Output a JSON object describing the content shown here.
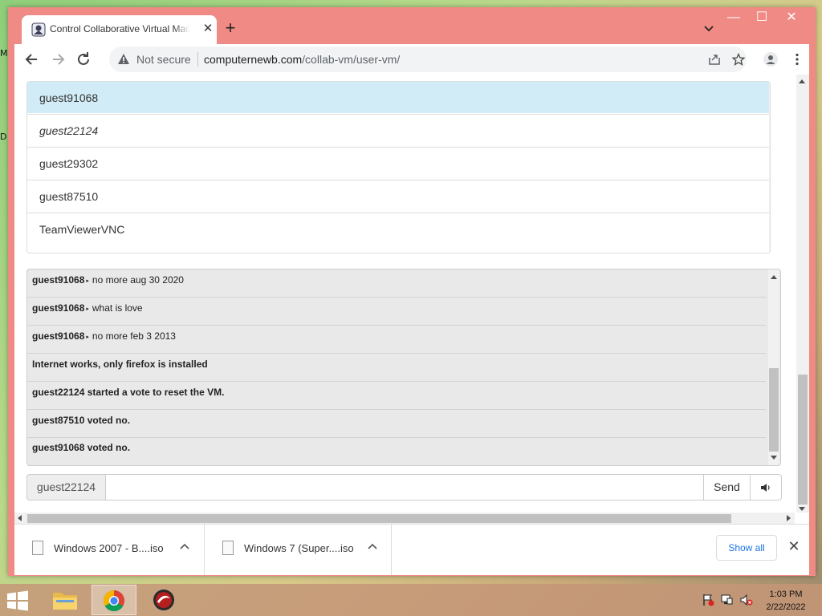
{
  "desktop": {
    "icon_labels": [
      "M",
      "D"
    ]
  },
  "tab": {
    "title": "Control Collaborative Virtual Machine",
    "close": "✕"
  },
  "window_controls": {
    "minimize": "—",
    "maximize": "☐",
    "close": "✕"
  },
  "new_tab": "+",
  "omnibox": {
    "security": "Not secure",
    "url_host": "computernewb.com",
    "url_path": "/collab-vm/user-vm/"
  },
  "users": [
    "guest91068",
    "guest22124",
    "guest29302",
    "guest87510",
    "TeamViewerVNC"
  ],
  "chat": {
    "messages": [
      {
        "user": "guest91068",
        "text": "no more aug 30 2020"
      },
      {
        "user": "guest91068",
        "text": "what is love"
      },
      {
        "user": "guest91068",
        "text": "no more feb 3 2013"
      }
    ],
    "system": [
      "Internet works, only firefox is installed",
      "guest22124 started a vote to reset the VM.",
      "guest87510 voted no.",
      "guest91068 voted no."
    ],
    "username": "guest22124",
    "send_label": "Send"
  },
  "downloads": {
    "items": [
      {
        "name": "Windows 2007 - B....iso"
      },
      {
        "name": "Windows 7 (Super....iso"
      }
    ],
    "show_all": "Show all"
  },
  "clock": {
    "time": "1:03 PM",
    "date": "2/22/2022"
  }
}
